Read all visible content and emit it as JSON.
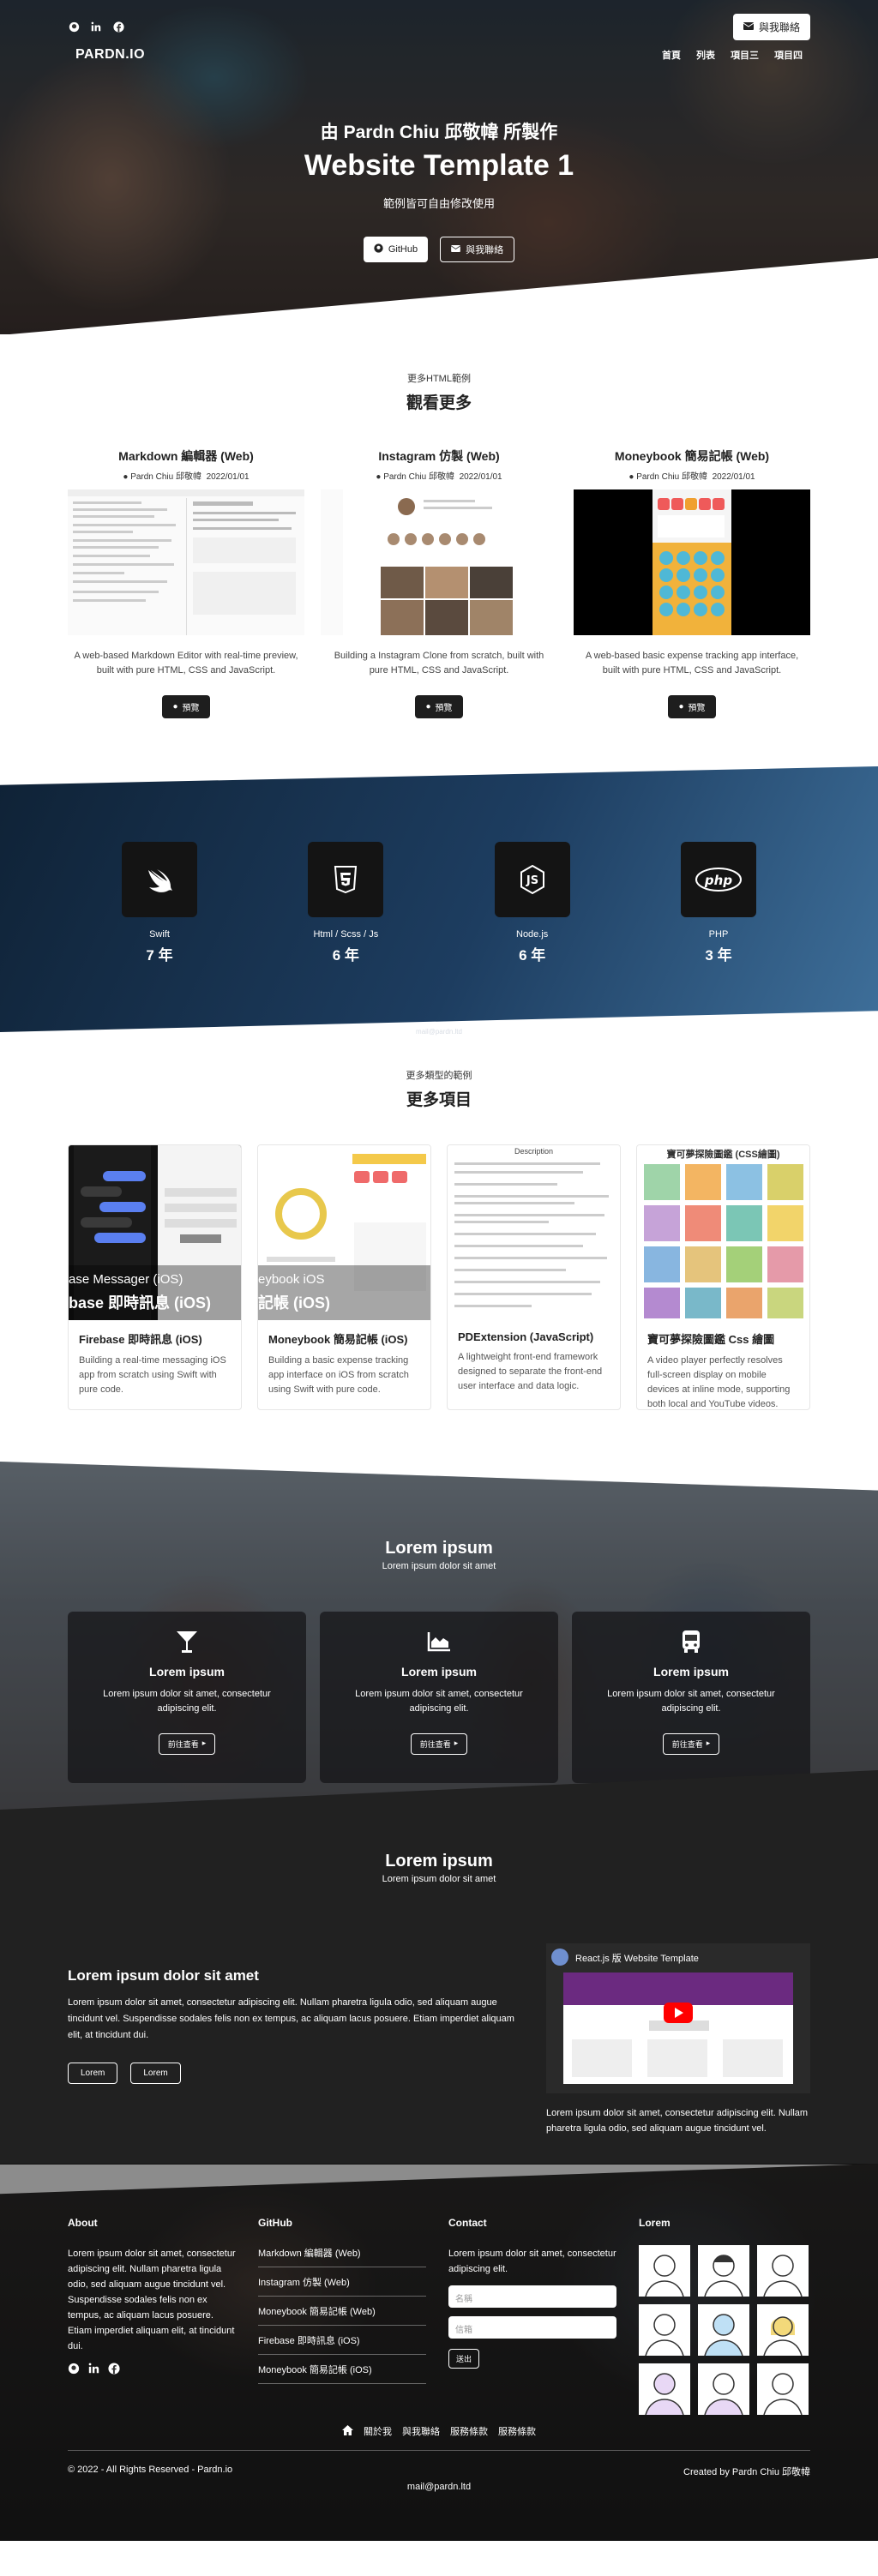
{
  "hero": {
    "contact_btn": "與我聯絡",
    "brand": "PARDN.IO",
    "nav": [
      "首頁",
      "列表",
      "項目三",
      "項目四"
    ],
    "subtitle": "由 Pardn Chiu 邱敬幃 所製作",
    "title": "Website Template 1",
    "desc": "範例皆可自由修改使用",
    "github_btn": "GitHub",
    "contact_btn2": "與我聯絡"
  },
  "more": {
    "small": "更多HTML範例",
    "title": "觀看更多",
    "items": [
      {
        "title": "Markdown 編輯器 (Web)",
        "author": "Pardn Chiu 邱敬幃",
        "date": "2022/01/01",
        "desc": "A web-based Markdown Editor with real-time preview, built with pure HTML, CSS and JavaScript.",
        "btn": "預覽"
      },
      {
        "title": "Instagram 仿製 (Web)",
        "author": "Pardn Chiu 邱敬幃",
        "date": "2022/01/01",
        "desc": "Building a Instagram Clone from scratch, built with pure HTML, CSS and JavaScript.",
        "btn": "預覽"
      },
      {
        "title": "Moneybook 簡易記帳 (Web)",
        "author": "Pardn Chiu 邱敬幃",
        "date": "2022/01/01",
        "desc": "A web-based basic expense tracking app interface, built with pure HTML, CSS and JavaScript.",
        "btn": "預覽"
      }
    ]
  },
  "skills": [
    {
      "name": "Swift",
      "years": "7 年",
      "icon": "swift-icon"
    },
    {
      "name": "Html / Scss / Js",
      "years": "6 年",
      "icon": "html5-icon"
    },
    {
      "name": "Node.js",
      "years": "6 年",
      "icon": "nodejs-icon"
    },
    {
      "name": "PHP",
      "years": "3 年",
      "icon": "php-icon"
    }
  ],
  "ghost_text": "mail@pardn.ltd",
  "moreprojects": {
    "small": "更多類型的範例",
    "title": "更多項目",
    "items": [
      {
        "title": "Firebase 即時訊息 (iOS)",
        "desc": "Building a real-time messaging iOS app from scratch using Swift with pure code.",
        "overlay": "ase Messager (iOS)",
        "overlay2": "base 即時訊息 (iOS)"
      },
      {
        "title": "Moneybook 簡易記帳 (iOS)",
        "desc": "Building a basic expense tracking app interface on iOS from scratch using Swift with pure code.",
        "overlay": "eybook iOS",
        "overlay2": "記帳 (iOS)"
      },
      {
        "title": "PDExtension (JavaScript)",
        "desc": "A lightweight front-end framework designed to separate the front-end user interface and data logic.",
        "shot_title": "Description"
      },
      {
        "title": "寶可夢探險圖鑑 Css 繪圖",
        "desc": "A video player perfectly resolves full-screen display on mobile devices at inline mode, supporting both local and YouTube videos.",
        "shot_title": "寶可夢探險圖鑑 (CSS繪圖)"
      }
    ]
  },
  "features": {
    "title": "Lorem ipsum",
    "sub": "Lorem ipsum dolor sit amet",
    "items": [
      {
        "icon": "cocktail-icon",
        "title": "Lorem ipsum",
        "desc": "Lorem ipsum dolor sit amet, consectetur adipiscing elit.",
        "btn": "前往查看"
      },
      {
        "icon": "area-chart-icon",
        "title": "Lorem ipsum",
        "desc": "Lorem ipsum dolor sit amet, consectetur adipiscing elit.",
        "btn": "前往查看"
      },
      {
        "icon": "bus-icon",
        "title": "Lorem ipsum",
        "desc": "Lorem ipsum dolor sit amet, consectetur adipiscing elit.",
        "btn": "前往查看"
      }
    ]
  },
  "dark": {
    "title": "Lorem ipsum",
    "sub": "Lorem ipsum dolor sit amet",
    "left_title": "Lorem ipsum dolor sit amet",
    "left_desc": "Lorem ipsum dolor sit amet, consectetur adipiscing elit. Nullam pharetra ligula odio, sed aliquam augue tincidunt vel. Suspendisse sodales felis non ex tempus, ac aliquam lacus posuere. Etiam imperdiet aliquam elit, at tincidunt dui.",
    "btn1": "Lorem",
    "btn2": "Lorem",
    "video_title": "React.js 版 Website Template",
    "right_desc": "Lorem ipsum dolor sit amet, consectetur adipiscing elit. Nullam pharetra ligula odio, sed aliquam augue tincidunt vel."
  },
  "footer": {
    "about_title": "About",
    "about_desc": "Lorem ipsum dolor sit amet, consectetur adipiscing elit. Nullam pharetra ligula odio, sed aliquam augue tincidunt vel. Suspendisse sodales felis non ex tempus, ac aliquam lacus posuere. Etiam imperdiet aliquam elit, at tincidunt dui.",
    "github_title": "GitHub",
    "github_links": [
      "Markdown 編輯器 (Web)",
      "Instagram 仿製 (Web)",
      "Moneybook 簡易記帳 (Web)",
      "Firebase 即時訊息 (iOS)",
      "Moneybook 簡易記帳 (iOS)"
    ],
    "contact_title": "Contact",
    "contact_desc": "Lorem ipsum dolor sit amet, consectetur adipiscing elit.",
    "name_placeholder": "名稱",
    "email_placeholder": "信箱",
    "send_btn": "送出",
    "gallery_title": "Lorem",
    "links": [
      "關於我",
      "與我聯絡",
      "服務條款",
      "服務條款"
    ],
    "copyright": "© 2022 - All Rights Reserved - Pardn.io",
    "credit": "Created by Pardn Chiu 邱敬幃",
    "mail": "mail@pardn.ltd"
  }
}
